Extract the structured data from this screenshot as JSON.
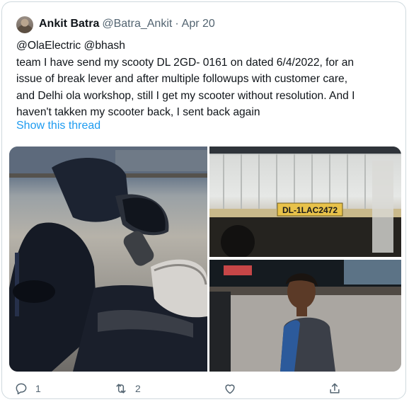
{
  "tweet": {
    "author_name": "Ankit Batra",
    "author_handle": "@Batra_Ankit",
    "separator": "·",
    "date": "Apr 20",
    "mentions": "@OlaElectric @bhash",
    "lines": [
      " team I have send my scooty DL 2GD- 0161 on dated 6/4/2022, for an",
      "issue of break lever and after multiple followups with customer care,",
      "and Delhi ola workshop, still I get my scooter without resolution. And I",
      "haven't takken my scooter back, I sent back again"
    ],
    "show_thread": "Show this thread"
  },
  "media": {
    "plate_text": "DL-1LAC2472"
  },
  "actions": {
    "reply_count": "1",
    "retweet_count": "2"
  },
  "colors": {
    "link": "#1d9bf0",
    "secondary": "#536471",
    "border": "#cfd9de"
  },
  "icons": [
    "reply-icon",
    "retweet-icon",
    "like-icon",
    "share-icon"
  ]
}
